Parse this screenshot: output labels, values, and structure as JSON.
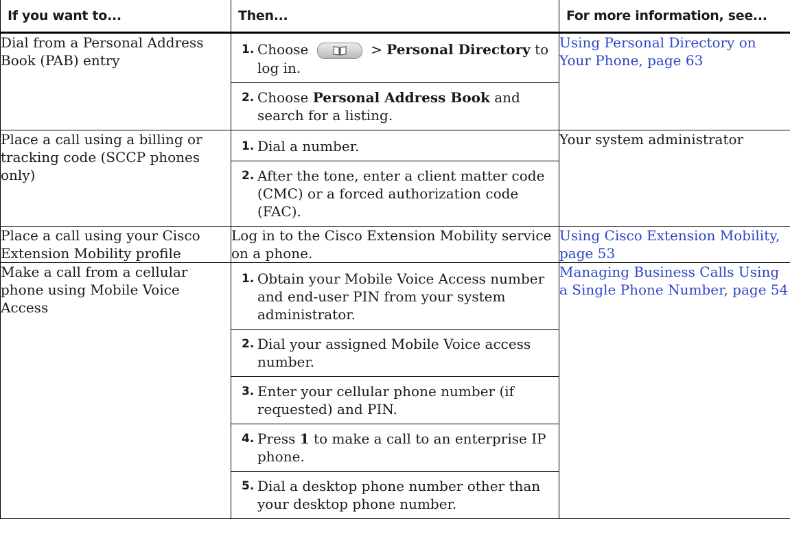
{
  "headers": [
    "If you want to...",
    "Then...",
    "For more information, see..."
  ],
  "rows": [
    {
      "want": "Dial from a Personal Address Book (PAB) entry",
      "steps": [
        {
          "num": "1.",
          "pre": "Choose",
          "icon": "directories-icon",
          "mid": " > ",
          "bold1": "Personal Directory",
          "post": " to log in."
        },
        {
          "num": "2.",
          "pre": "Choose ",
          "bold1": "Personal Address Book",
          "post": " and search for a listing."
        }
      ],
      "info": "Using Personal Directory on Your Phone, page 63",
      "info_is_link": true
    },
    {
      "want": "Place a call using a billing or tracking code (SCCP phones only)",
      "steps": [
        {
          "num": "1.",
          "text": "Dial a number."
        },
        {
          "num": "2.",
          "text": "After the tone, enter a client matter code (CMC) or a forced authorization code (FAC)."
        }
      ],
      "info": "Your system administrator",
      "info_is_link": false
    },
    {
      "want": "Place a call using your Cisco Extension Mobility profile",
      "then_text": "Log in to the Cisco Extension Mobility service on a phone.",
      "info": "Using Cisco Extension Mobility, page 53",
      "info_is_link": true
    },
    {
      "want": "Make a call from a cellular phone using Mobile Voice Access",
      "steps": [
        {
          "num": "1.",
          "text": "Obtain your Mobile Voice Access number and end-user PIN from your system administrator."
        },
        {
          "num": "2.",
          "text": "Dial your assigned Mobile Voice access number."
        },
        {
          "num": "3.",
          "text": "Enter your cellular phone number (if requested) and PIN."
        },
        {
          "num": "4.",
          "pre": "Press ",
          "bold1": "1",
          "post": " to make a call to an enterprise IP phone."
        },
        {
          "num": "5.",
          "text": "Dial a desktop phone number other than your desktop phone number."
        }
      ],
      "info": "Managing Business Calls Using a Single Phone Number, page 54",
      "info_is_link": true
    }
  ]
}
